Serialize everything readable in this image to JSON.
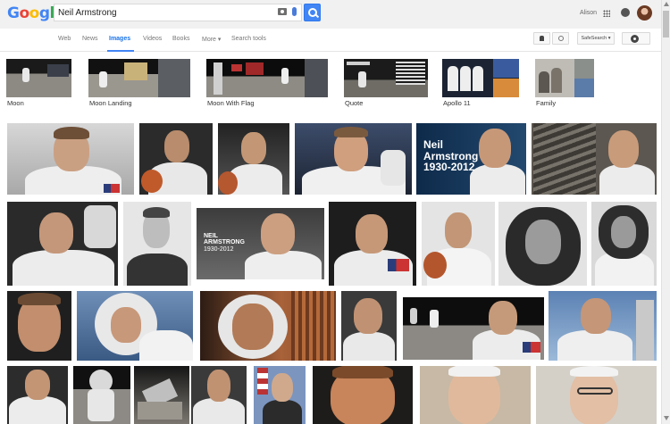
{
  "logo": {
    "text": "Google",
    "colors": [
      "#4285f4",
      "#ea4335",
      "#fbbc05",
      "#4285f4",
      "#34a853",
      "#ea4335"
    ]
  },
  "search": {
    "query": "Neil Armstrong"
  },
  "account": {
    "name": "Alison"
  },
  "tabs": [
    {
      "label": "Web",
      "active": false
    },
    {
      "label": "News",
      "active": false
    },
    {
      "label": "Images",
      "active": true
    },
    {
      "label": "Videos",
      "active": false
    },
    {
      "label": "Books",
      "active": false
    },
    {
      "label": "More ▾",
      "active": false
    },
    {
      "label": "Search tools",
      "active": false
    }
  ],
  "toolbar": {
    "safesearch_label": "SafeSearch ▾"
  },
  "related": [
    {
      "label": "Moon"
    },
    {
      "label": "Moon Landing"
    },
    {
      "label": "Moon With Flag"
    },
    {
      "label": "Quote"
    },
    {
      "label": "Apollo 11"
    },
    {
      "label": "Family"
    }
  ],
  "overlays": {
    "t5": {
      "line1": "Neil",
      "line2": "Armstrong",
      "line3": "1930-2012"
    },
    "t10": {
      "line1": "NEIL",
      "line2": "ARMSTRONG",
      "line3": "1930-2012"
    }
  },
  "colors": {
    "accent": "#4285f4",
    "header_bg": "#f1f1f1"
  }
}
